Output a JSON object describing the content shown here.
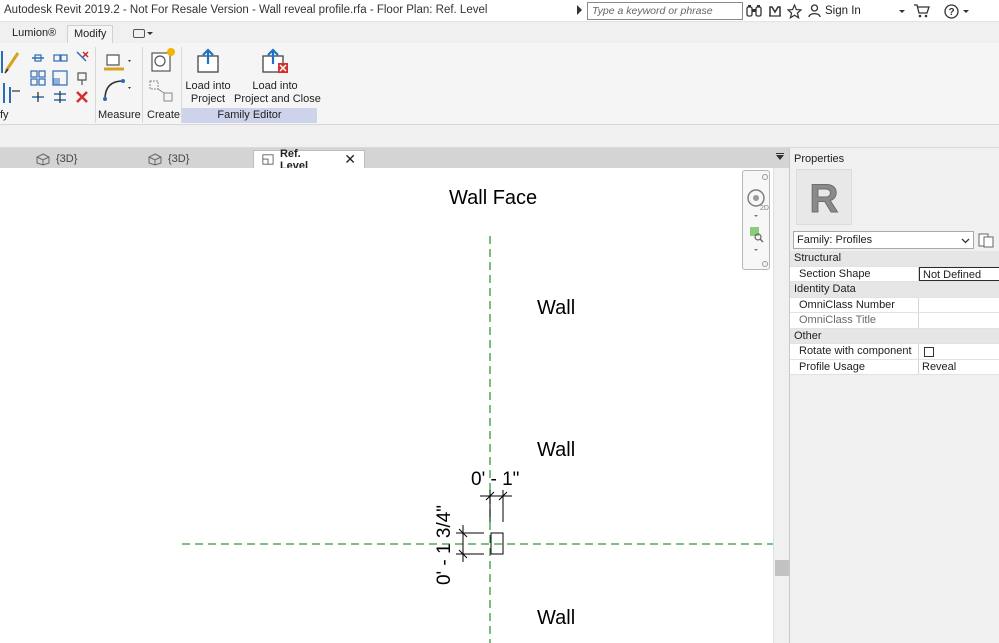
{
  "window": {
    "title": "Autodesk Revit 2019.2 - Not For Resale Version - Wall reveal profile.rfa - Floor Plan: Ref. Level",
    "search_placeholder": "Type a keyword or phrase",
    "sign_in": "Sign In"
  },
  "ribbon": {
    "tabs": [
      {
        "label": "Lumion®"
      },
      {
        "label": "Modify",
        "active": true
      }
    ],
    "panel_labels": {
      "modify_partial": "fy",
      "measure": "Measure",
      "create": "Create",
      "family_editor": "Family Editor"
    },
    "buttons": {
      "load_into_project": "Load into\nProject",
      "load_into_project_close": "Load into\nProject and Close"
    }
  },
  "view_tabs": [
    {
      "label": "{3D}",
      "active": false
    },
    {
      "label": "{3D}",
      "active": false
    },
    {
      "label": "Ref. Level",
      "active": true
    }
  ],
  "canvas": {
    "labels": {
      "wall_face": "Wall Face",
      "wall_1": "Wall",
      "wall_2": "Wall",
      "wall_3": "Wall",
      "dim_horizontal": "0' - 1\"",
      "dim_vertical": "0' - 1 3/4\""
    },
    "colors": {
      "ref_plane": "#2e9a3a",
      "dimension": "#000000"
    }
  },
  "properties": {
    "title": "Properties",
    "type_selector": "Family: Profiles",
    "groups": [
      {
        "name": "Structural",
        "rows": [
          {
            "key": "Section Shape",
            "value": "Not Defined",
            "boxed": true
          }
        ]
      },
      {
        "name": "Identity Data",
        "rows": [
          {
            "key": "OmniClass Number",
            "value": ""
          },
          {
            "key": "OmniClass Title",
            "value": "",
            "dim": true
          }
        ]
      },
      {
        "name": "Other",
        "rows": [
          {
            "key": "Rotate with component",
            "value": "",
            "checkbox": true
          },
          {
            "key": "Profile Usage",
            "value": "Reveal"
          }
        ]
      }
    ]
  }
}
